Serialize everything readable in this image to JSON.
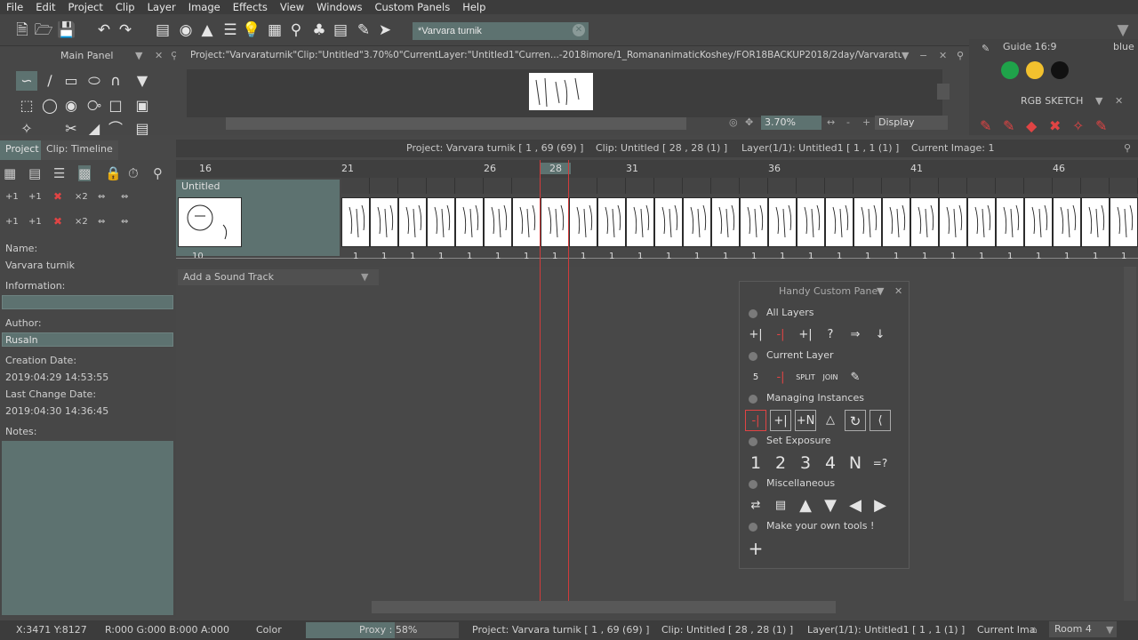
{
  "menu": [
    "File",
    "Edit",
    "Project",
    "Clip",
    "Layer",
    "Image",
    "Effects",
    "View",
    "Windows",
    "Custom Panels",
    "Help"
  ],
  "search": {
    "value": "*Varvara turnik"
  },
  "main_panel": {
    "title": "Main Panel"
  },
  "viewer": {
    "path": "Project:\"Varvaraturnik\"Clip:\"Untitled\"3.70%0\"CurrentLayer:\"Untitled1\"Curren...-2018imore/1_RomananimaticKoshey/FOR18BACKUP2018/2day/Varvaraturnik.tvpp)",
    "zoom": "3.70%",
    "display": "Display"
  },
  "right_panel": {
    "guide": "Guide 16:9",
    "blue": "blue",
    "title": "RGB SKETCH",
    "colors": [
      "#1fa34a",
      "#f2c12e",
      "#111111"
    ]
  },
  "tabs": {
    "project": "Project",
    "timeline": "Clip: Timeline"
  },
  "status_info": {
    "project": "Project: Varvara turnik [ 1 , 69  (69) ]",
    "clip": "Clip: Untitled [ 28 , 28  (1) ]",
    "layer": "Layer(1/1): Untitled1 [ 1 , 1  (1) ]",
    "image": "Current Image: 1"
  },
  "ruler": {
    "ticks": [
      "16",
      "21",
      "26",
      "28",
      "31",
      "36",
      "41",
      "46"
    ]
  },
  "track": {
    "layer_name": "Untitled",
    "first_exposure": "10",
    "exposure": "1"
  },
  "sound": {
    "label": "Add a Sound Track"
  },
  "project_info": {
    "name_label": "Name:",
    "name": "Varvara turnik",
    "info_label": "Information:",
    "author_label": "Author:",
    "author": "Rusaln",
    "creation_label": "Creation Date:",
    "creation": "2019:04:29 14:53:55",
    "change_label": "Last Change Date:",
    "change": "2019:04:30 14:36:45",
    "notes_label": "Notes:"
  },
  "handy": {
    "title": "Handy Custom Pane",
    "sections": [
      "All Layers",
      "Current Layer",
      "Managing Instances",
      "Set Exposure",
      "Miscellaneous",
      "Make your own tools !"
    ],
    "exposure_buttons": [
      "1",
      "2",
      "3",
      "4",
      "N",
      "=?"
    ]
  },
  "bottom": {
    "coords": "X:3471  Y:8127",
    "rgba": "R:000 G:000 B:000 A:000",
    "color": "Color",
    "proxy": "Proxy : 58%",
    "project": "Project: Varvara turnik [ 1 , 69  (69) ]",
    "clip": "Clip: Untitled [ 28 , 28  (1) ]",
    "layer": "Layer(1/1): Untitled1 [ 1 , 1  (1) ]",
    "current": "Current Ima",
    "room": "Room 4"
  }
}
